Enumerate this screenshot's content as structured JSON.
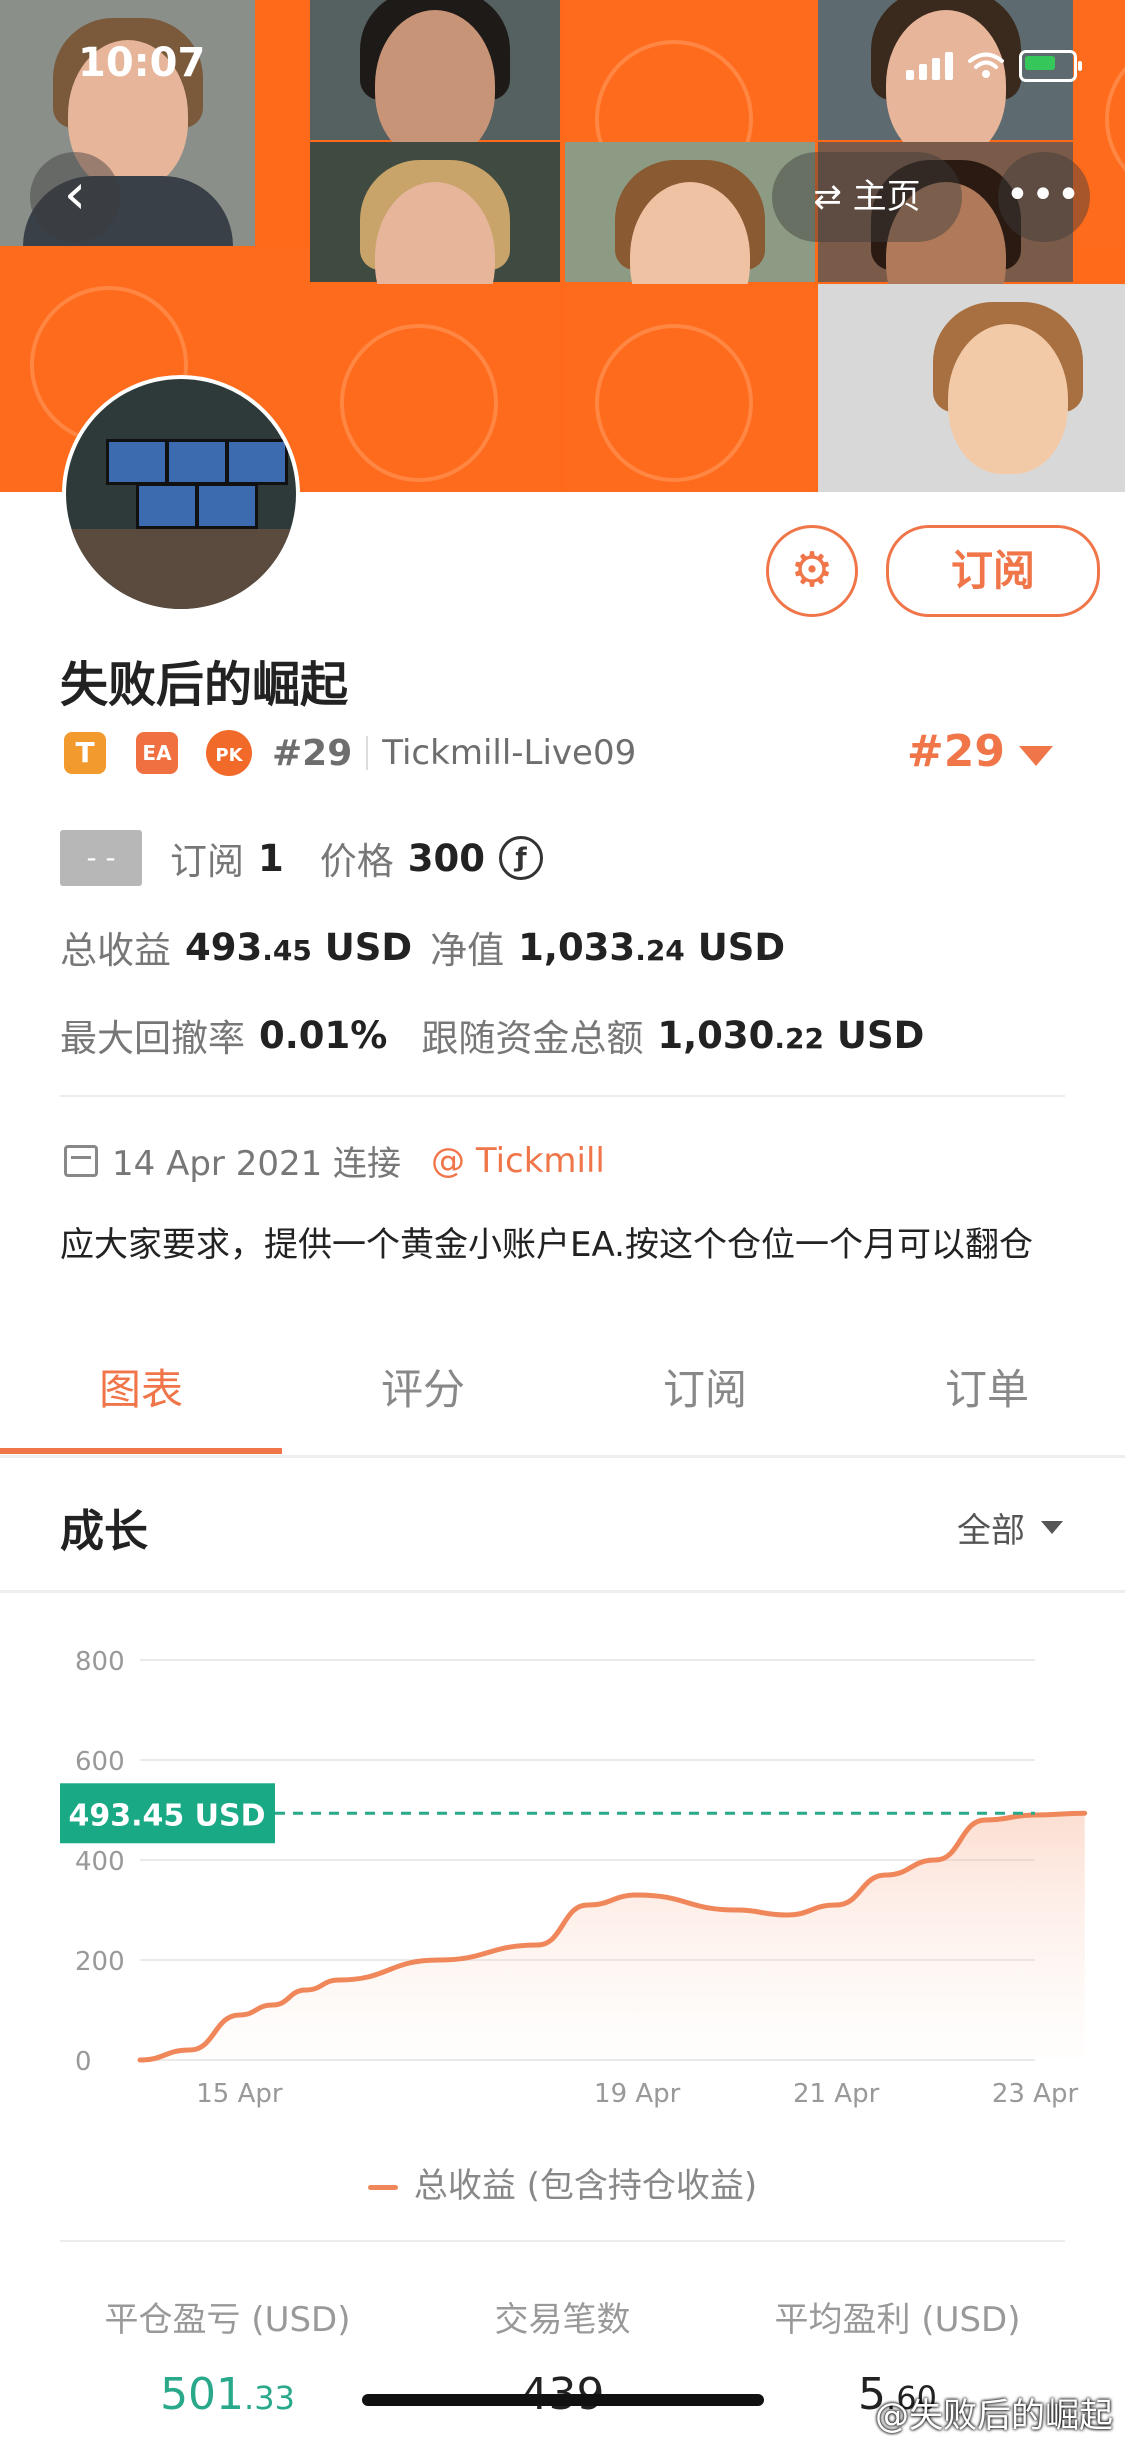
{
  "status_bar": {
    "time": "10:07"
  },
  "header": {
    "back_glyph": "‹",
    "home_label": "⇄ 主页",
    "more_glyph": "•••"
  },
  "profile": {
    "name": "失败后的崛起",
    "gear_glyph": "⚙",
    "subscribe_label": "订阅",
    "tags": {
      "t": "T",
      "ea": "EA",
      "pk": "PK",
      "rank": "#29",
      "server": "Tickmill-Live09"
    },
    "rank_right": "#29"
  },
  "stats": {
    "status_chip": "- -",
    "subscribe_label": "订阅",
    "subscribe_count": "1",
    "price_label": "价格",
    "price_value": "300",
    "price_icon": "ƒ",
    "total_profit_label": "总收益",
    "total_profit_int": "493",
    "total_profit_dec": ".45",
    "total_profit_unit": "USD",
    "equity_label": "净值",
    "equity_int": "1,033",
    "equity_dec": ".24",
    "equity_unit": "USD",
    "drawdown_label": "最大回撤率",
    "drawdown_value": "0.01%",
    "follow_label": "跟随资金总额",
    "follow_int": "1,030",
    "follow_dec": ".22",
    "follow_unit": "USD"
  },
  "connection": {
    "date": "14 Apr 2021 连接",
    "broker": "@ Tickmill"
  },
  "description": "应大家要求，提供一个黄金小账户EA.按这个仓位一个月可以翻仓",
  "tabs": [
    "图表",
    "评分",
    "订阅",
    "订单"
  ],
  "section": {
    "title": "成长",
    "range": "全部"
  },
  "chart_data": {
    "type": "area",
    "x_ticks": [
      "15 Apr",
      "19 Apr",
      "21 Apr",
      "23 Apr"
    ],
    "y_ticks": [
      0,
      200,
      400,
      600,
      800
    ],
    "ylim": [
      0,
      800
    ],
    "series": [
      {
        "name": "总收益 (包含持仓收益)",
        "x": [
          "14 Apr",
          "14 Apr",
          "15 Apr",
          "15 Apr",
          "15 Apr",
          "16 Apr",
          "17 Apr",
          "18 Apr",
          "18 Apr",
          "19 Apr",
          "20 Apr",
          "20 Apr",
          "21 Apr",
          "21 Apr",
          "22 Apr",
          "22 Apr",
          "23 Apr",
          "23 Apr"
        ],
        "values": [
          0,
          20,
          90,
          110,
          140,
          160,
          200,
          230,
          310,
          330,
          300,
          290,
          310,
          370,
          400,
          480,
          490,
          493.45
        ]
      }
    ],
    "current_label": "493.45 USD",
    "current_value": 493.45,
    "colors": {
      "line": "#f0875a",
      "reference": "#2aa88a",
      "label_bg": "#19a985"
    }
  },
  "bottom_stats": [
    {
      "label": "平仓盈亏 (USD)",
      "int": "501",
      "dec": ".33",
      "color": "green"
    },
    {
      "label": "交易笔数",
      "int": "439",
      "dec": "",
      "color": "dark"
    },
    {
      "label": "平均盈利 (USD)",
      "int": "5",
      "dec": ".60",
      "color": "dark"
    }
  ],
  "watermark": "@失败后的崛起"
}
